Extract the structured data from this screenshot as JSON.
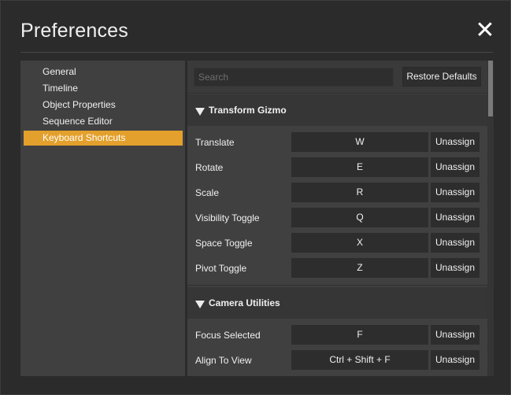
{
  "window": {
    "title": "Preferences",
    "close_icon": "close-icon"
  },
  "sidebar": {
    "items": [
      {
        "label": "General"
      },
      {
        "label": "Timeline"
      },
      {
        "label": "Object Properties"
      },
      {
        "label": "Sequence Editor"
      },
      {
        "label": "Keyboard Shortcuts"
      }
    ],
    "selected": "Keyboard Shortcuts",
    "accent_color": "#e3a02c"
  },
  "shortcuts": {
    "search_placeholder": "Search",
    "restore_label": "Restore Defaults",
    "sections": [
      {
        "title": "Transform Gizmo",
        "rows": [
          {
            "action": "Translate",
            "key": "W",
            "unassign": "Unassign"
          },
          {
            "action": "Rotate",
            "key": "E",
            "unassign": "Unassign"
          },
          {
            "action": "Scale",
            "key": "R",
            "unassign": "Unassign"
          },
          {
            "action": "Visibility Toggle",
            "key": "Q",
            "unassign": "Unassign"
          },
          {
            "action": "Space Toggle",
            "key": "X",
            "unassign": "Unassign"
          },
          {
            "action": "Pivot Toggle",
            "key": "Z",
            "unassign": "Unassign"
          }
        ]
      },
      {
        "title": "Camera Utilities",
        "rows": [
          {
            "action": "Focus Selected",
            "key": "F",
            "unassign": "Unassign"
          },
          {
            "action": "Align To View",
            "key": "Ctrl + Shift + F",
            "unassign": "Unassign"
          }
        ]
      }
    ]
  }
}
